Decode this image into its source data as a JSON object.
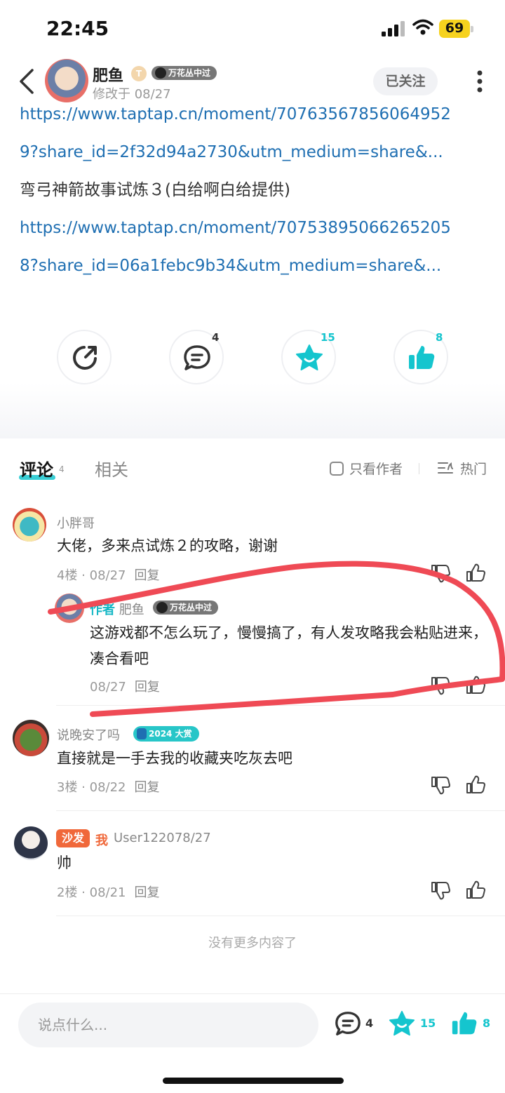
{
  "status_bar": {
    "time": "22:45",
    "battery": "69"
  },
  "header": {
    "author_name": "肥鱼",
    "level_badge": "T",
    "tag": "万花丛中过",
    "edited": "修改于 08/27",
    "follow_label": "已关注"
  },
  "post": {
    "lines": [
      {
        "type": "link",
        "text": "https://www.taptap.cn/moment/70763567856064952"
      },
      {
        "type": "link",
        "text": "9?share_id=2f32d94a2730&utm_medium=share&..."
      },
      {
        "type": "plain",
        "text": "弯弓神箭故事试炼３(白给啊白给提供)"
      },
      {
        "type": "link",
        "text": "https://www.taptap.cn/moment/70753895066265205"
      },
      {
        "type": "link",
        "text": "8?share_id=06a1febc9b34&utm_medium=share&..."
      }
    ]
  },
  "actions": {
    "comment_count": "4",
    "favorite_count": "15",
    "like_count": "8"
  },
  "tabs": {
    "active": "评论",
    "active_count": "4",
    "inactive": "相关",
    "only_author": "只看作者",
    "sort": "热门"
  },
  "comments": [
    {
      "name": "小胖哥",
      "text": "大佬，多来点试炼２的攻略，谢谢",
      "meta": "4楼 · 08/27",
      "reply": "回复"
    },
    {
      "author_label": "作者",
      "name": "肥鱼",
      "tag": "万花丛中过",
      "text": "这游戏都不怎么玩了，慢慢搞了，有人发攻略我会粘贴进来，凑合看吧",
      "meta": "08/27",
      "reply": "回复"
    },
    {
      "name": "说晚安了吗",
      "award": "2024 大赏",
      "text": "直接就是一手去我的收藏夹吃灰去吧",
      "meta": "3楼 · 08/22",
      "reply": "回复"
    },
    {
      "sofa": "沙发",
      "me": "我",
      "name": "User122078/27",
      "text": "帅",
      "meta": "2楼 · 08/21",
      "reply": "回复"
    }
  ],
  "no_more": "没有更多内容了",
  "bottom_bar": {
    "placeholder": "说点什么...",
    "comment_count": "4",
    "favorite_count": "15",
    "like_count": "8"
  },
  "colors": {
    "accent": "#15c5ce",
    "link": "#1f6fb2",
    "sofa": "#f0683a",
    "annotation": "#ef4a55"
  }
}
